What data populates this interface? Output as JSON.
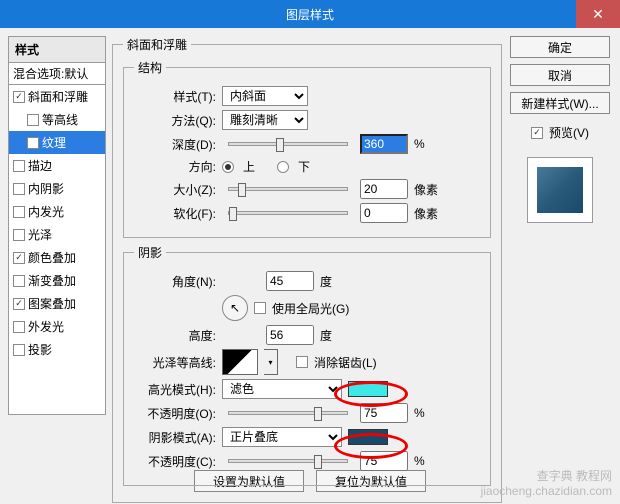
{
  "title": "图层样式",
  "styles": {
    "header": "样式",
    "blend_defaults": "混合选项:默认",
    "items": [
      {
        "label": "斜面和浮雕",
        "checked": true,
        "selected": false,
        "indent": false
      },
      {
        "label": "等高线",
        "checked": false,
        "selected": false,
        "indent": true
      },
      {
        "label": "纹理",
        "checked": false,
        "selected": true,
        "indent": true
      },
      {
        "label": "描边",
        "checked": false,
        "selected": false,
        "indent": false
      },
      {
        "label": "内阴影",
        "checked": false,
        "selected": false,
        "indent": false
      },
      {
        "label": "内发光",
        "checked": false,
        "selected": false,
        "indent": false
      },
      {
        "label": "光泽",
        "checked": false,
        "selected": false,
        "indent": false
      },
      {
        "label": "颜色叠加",
        "checked": true,
        "selected": false,
        "indent": false
      },
      {
        "label": "渐变叠加",
        "checked": false,
        "selected": false,
        "indent": false
      },
      {
        "label": "图案叠加",
        "checked": true,
        "selected": false,
        "indent": false
      },
      {
        "label": "外发光",
        "checked": false,
        "selected": false,
        "indent": false
      },
      {
        "label": "投影",
        "checked": false,
        "selected": false,
        "indent": false
      }
    ]
  },
  "bevel": {
    "group_title": "斜面和浮雕",
    "structure": "结构",
    "style_lbl": "样式(T):",
    "style_val": "内斜面",
    "method_lbl": "方法(Q):",
    "method_val": "雕刻清晰",
    "depth_lbl": "深度(D):",
    "depth_val": "360",
    "pct": "%",
    "dir_lbl": "方向:",
    "up": "上",
    "down": "下",
    "size_lbl": "大小(Z):",
    "size_val": "20",
    "px": "像素",
    "soften_lbl": "软化(F):",
    "soften_val": "0"
  },
  "shading": {
    "group_title": "阴影",
    "angle_lbl": "角度(N):",
    "angle_val": "45",
    "deg": "度",
    "global": "使用全局光(G)",
    "alt_lbl": "高度:",
    "alt_val": "56",
    "gloss_lbl": "光泽等高线:",
    "aa": "消除锯齿(L)",
    "hl_mode_lbl": "高光模式(H):",
    "hl_mode_val": "滤色",
    "hl_color": "#3fe8e8",
    "hl_op_lbl": "不透明度(O):",
    "hl_op_val": "75",
    "sh_mode_lbl": "阴影模式(A):",
    "sh_mode_val": "正片叠底",
    "sh_color": "#1a4a6a",
    "sh_op_lbl": "不透明度(C):",
    "sh_op_val": "75"
  },
  "buttons": {
    "ok": "确定",
    "cancel": "取消",
    "new_style": "新建样式(W)...",
    "preview": "预览(V)",
    "reset": "设置为默认值",
    "restore": "复位为默认值"
  },
  "watermark": {
    "l1": "查字典 教程网",
    "l2": "jiaocheng.chazidian.com"
  }
}
